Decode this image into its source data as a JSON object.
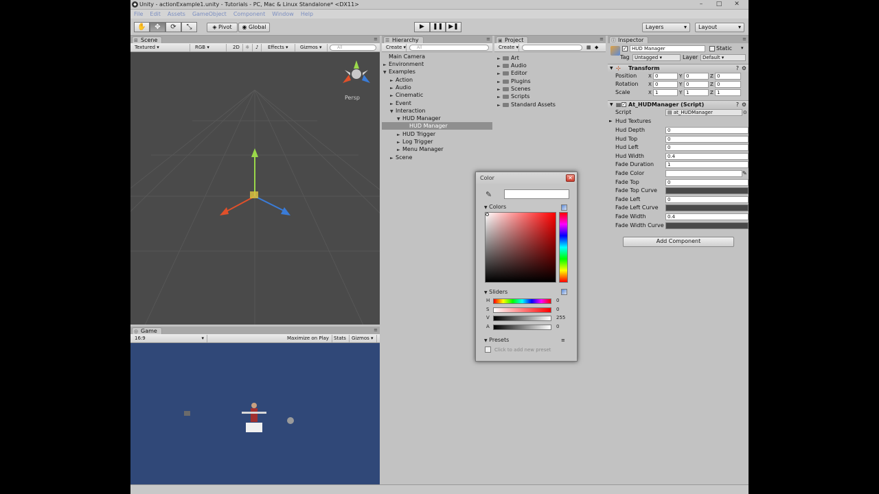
{
  "window": {
    "title": "Unity - actionExample1.unity - Tutorials - PC, Mac & Linux Standalone* <DX11>",
    "app_icon": "unity-icon"
  },
  "menu": [
    "File",
    "Edit",
    "Assets",
    "GameObject",
    "Component",
    "Window",
    "Help"
  ],
  "toolbar": {
    "pivot": "Pivot",
    "global": "Global",
    "layers": "Layers",
    "layout": "Layout"
  },
  "scene": {
    "tab": "Scene",
    "tools": {
      "shading": "Textured",
      "render": "RGB",
      "mode2d": "2D",
      "effects": "Effects",
      "gizmos": "Gizmos",
      "search": "All"
    },
    "persp": "Persp"
  },
  "game": {
    "tab": "Game",
    "aspect": "16:9",
    "maximize": "Maximize on Play",
    "stats": "Stats",
    "gizmos": "Gizmos"
  },
  "hierarchy": {
    "tab": "Hierarchy",
    "create": "Create",
    "search": "All",
    "items": [
      {
        "label": "Main Camera",
        "arrow": ""
      },
      {
        "label": "Environment",
        "arrow": "►"
      },
      {
        "label": "Examples",
        "arrow": "▼"
      },
      {
        "label": "Action",
        "arrow": "►"
      },
      {
        "label": "Audio",
        "arrow": "►"
      },
      {
        "label": "Cinematic",
        "arrow": "►"
      },
      {
        "label": "Event",
        "arrow": "►"
      },
      {
        "label": "Interaction",
        "arrow": "▼"
      },
      {
        "label": "HUD Manager",
        "arrow": "▼"
      },
      {
        "label": "HUD Manager",
        "arrow": ""
      },
      {
        "label": "HUD Trigger",
        "arrow": "►"
      },
      {
        "label": "Log Trigger",
        "arrow": "►"
      },
      {
        "label": "Menu Manager",
        "arrow": "►"
      },
      {
        "label": "Scene",
        "arrow": "►"
      }
    ]
  },
  "project": {
    "tab": "Project",
    "create": "Create",
    "folders": [
      "Art",
      "Audio",
      "Editor",
      "Plugins",
      "Scenes",
      "Scripts",
      "Standard Assets"
    ]
  },
  "inspector": {
    "tab": "Inspector",
    "object_name": "HUD Manager",
    "static_label": "Static",
    "tag_label": "Tag",
    "tag_value": "Untagged",
    "layer_label": "Layer",
    "layer_value": "Default",
    "transform": {
      "title": "Transform",
      "rows": [
        {
          "label": "Position",
          "x": "0",
          "y": "0",
          "z": "0"
        },
        {
          "label": "Rotation",
          "x": "0",
          "y": "0",
          "z": "0"
        },
        {
          "label": "Scale",
          "x": "1",
          "y": "1",
          "z": "1"
        }
      ]
    },
    "script": {
      "title": "At_HUDManager (Script)",
      "script_label": "Script",
      "script_value": "at_HUDManager",
      "foldout": "Hud Textures",
      "fields": [
        {
          "label": "Hud Depth",
          "value": "0",
          "kind": "text"
        },
        {
          "label": "Hud Top",
          "value": "0",
          "kind": "text"
        },
        {
          "label": "Hud Left",
          "value": "0",
          "kind": "text"
        },
        {
          "label": "Hud Width",
          "value": "0.4",
          "kind": "text"
        },
        {
          "label": "Fade Duration",
          "value": "1",
          "kind": "text"
        },
        {
          "label": "Fade Color",
          "value": "",
          "kind": "color"
        },
        {
          "label": "Fade Top",
          "value": "0",
          "kind": "text"
        },
        {
          "label": "Fade Top Curve",
          "value": "",
          "kind": "curve"
        },
        {
          "label": "Fade Left",
          "value": "0",
          "kind": "text"
        },
        {
          "label": "Fade Left Curve",
          "value": "",
          "kind": "curve"
        },
        {
          "label": "Fade Width",
          "value": "0.4",
          "kind": "text"
        },
        {
          "label": "Fade Width Curve",
          "value": "",
          "kind": "curve"
        }
      ]
    },
    "add_component": "Add Component"
  },
  "color_dialog": {
    "title": "Color",
    "colors_label": "Colors",
    "sliders_label": "Sliders",
    "presets_label": "Presets",
    "preset_hint": "Click to add new preset",
    "current_color": "#ffffff",
    "sliders": [
      {
        "label": "H",
        "value": "0"
      },
      {
        "label": "S",
        "value": "0"
      },
      {
        "label": "V",
        "value": "255"
      },
      {
        "label": "A",
        "value": "0"
      }
    ]
  }
}
